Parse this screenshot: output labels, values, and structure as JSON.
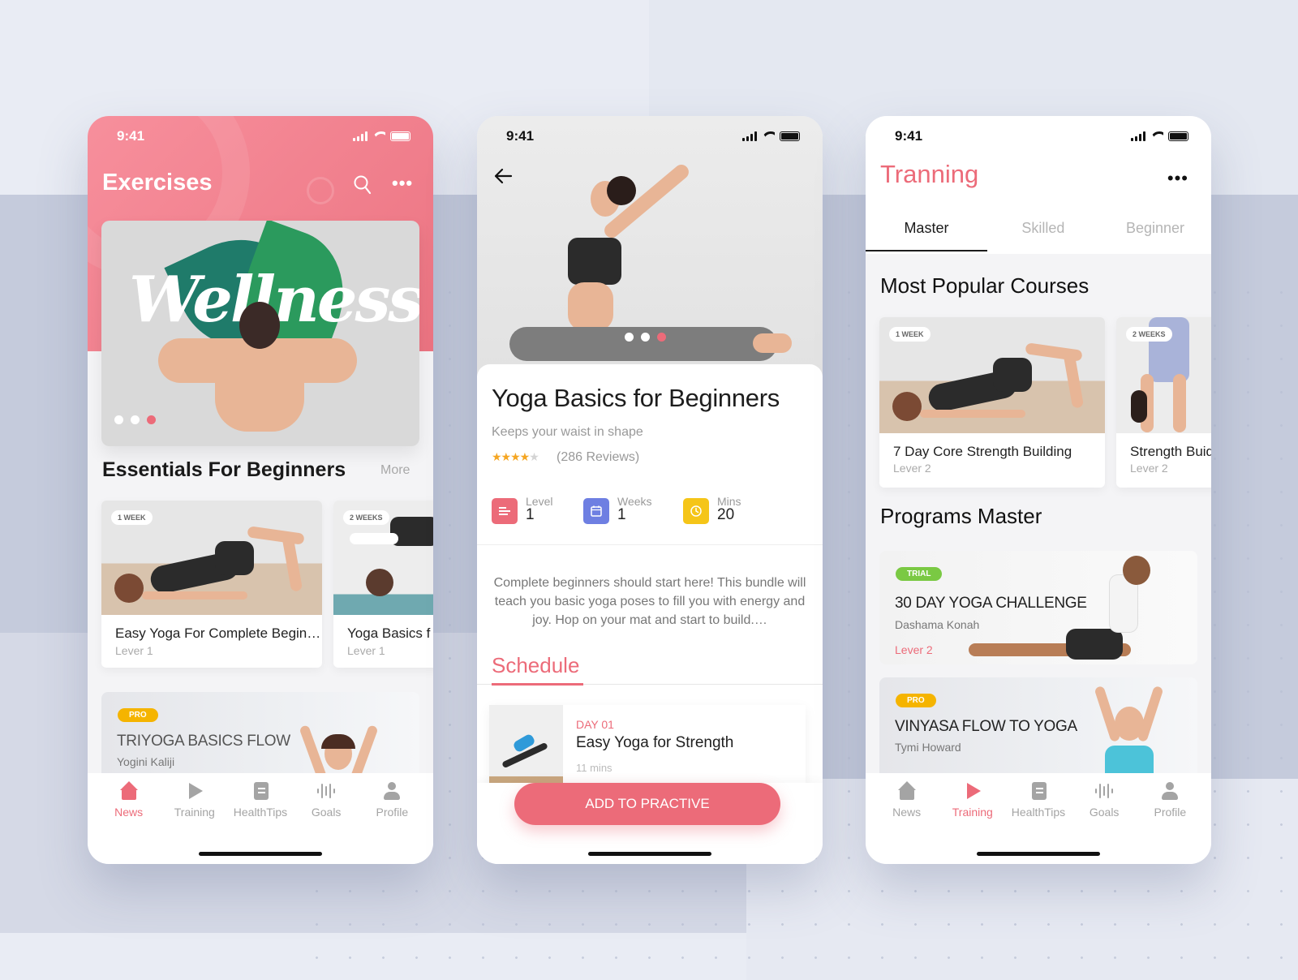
{
  "status_time": "9:41",
  "colors": {
    "accent": "#ec6b79",
    "pro": "#f5b400",
    "trial": "#7ac943",
    "weeks": "#6e7fe2",
    "level": "#ec6b79",
    "mins": "#f5c518"
  },
  "screen1": {
    "title": "Exercises",
    "banner_word": "Wellness",
    "pager": {
      "count": 3,
      "active": 3
    },
    "section_title": "Essentials For Beginners",
    "more_label": "More",
    "cards": [
      {
        "badge": "1 WEEK",
        "title": "Easy Yoga For Complete Begin…",
        "level": "Lever 1"
      },
      {
        "badge": "2 WEEKS",
        "title": "Yoga Basics f",
        "level": "Lever 1"
      }
    ],
    "program": {
      "tag": "PRO",
      "title": "TRIYOGA BASICS FLOW",
      "author": "Yogini Kaliji"
    },
    "tabs": [
      "News",
      "Training",
      "HealthTips",
      "Goals",
      "Profile"
    ],
    "active_tab": "News"
  },
  "screen2": {
    "pager": {
      "count": 3,
      "active": 3
    },
    "title": "Yoga Basics for Beginners",
    "subtitle": "Keeps your waist in shape",
    "rating": 4,
    "rating_max": 5,
    "reviews": "(286 Reviews)",
    "stats": [
      {
        "label": "Level",
        "value": "1",
        "icon": "bars-icon"
      },
      {
        "label": "Weeks",
        "value": "1",
        "icon": "calendar-icon"
      },
      {
        "label": "Mins",
        "value": "20",
        "icon": "clock-icon"
      }
    ],
    "description": "Complete beginners should start here! This bundle will teach you basic yoga poses to fill you with energy and joy. Hop on your mat and start to build.…",
    "schedule_title": "Schedule",
    "schedule": [
      {
        "day": "DAY 01",
        "title": "Easy Yoga for Strength",
        "duration": "11 mins"
      }
    ],
    "cta": "ADD TO PRACTIVE"
  },
  "screen3": {
    "title": "Tranning",
    "tabs": [
      "Master",
      "Skilled",
      "Beginner"
    ],
    "active_tab": "Training",
    "popular_title": "Most Popular Courses",
    "courses": [
      {
        "badge": "1 WEEK",
        "title": "7 Day Core Strength Building",
        "level": "Lever 2"
      },
      {
        "badge": "2 WEEKS",
        "title": "Strength Buid",
        "level": "Lever 2"
      }
    ],
    "programs_title": "Programs Master",
    "programs": [
      {
        "tag": "TRIAL",
        "title": "30 DAY YOGA CHALLENGE",
        "author": "Dashama Konah",
        "level": "Lever 2"
      },
      {
        "tag": "PRO",
        "title": "VINYASA FLOW TO YOGA",
        "author": "Tymi Howard"
      }
    ],
    "nav_tabs": [
      "News",
      "Training",
      "HealthTips",
      "Goals",
      "Profile"
    ]
  }
}
